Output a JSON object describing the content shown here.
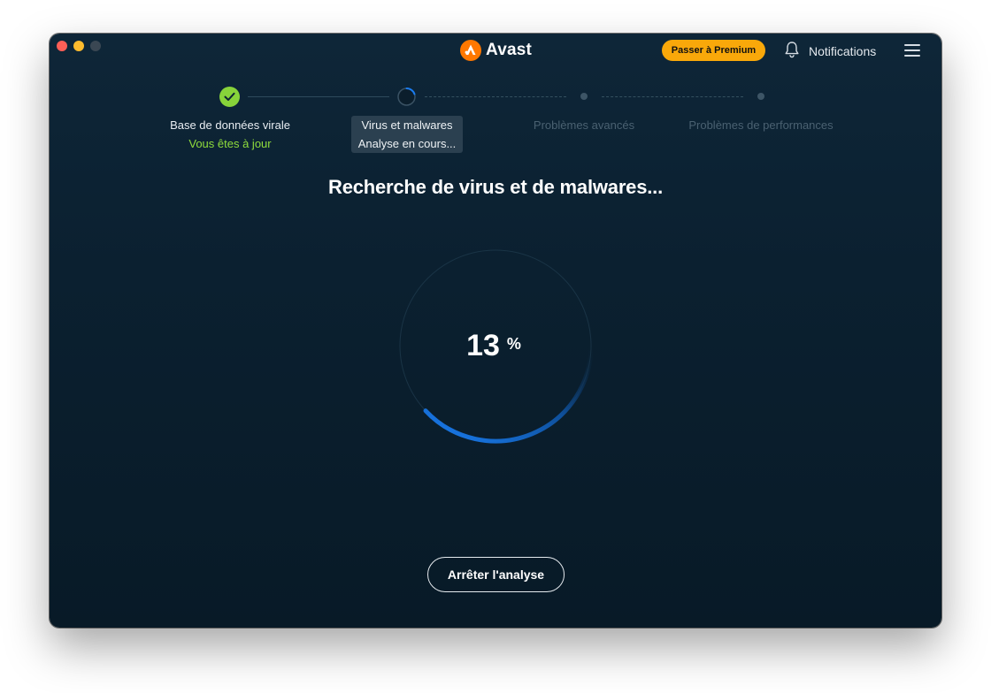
{
  "window": {
    "controls": [
      "close",
      "minimize",
      "zoom"
    ]
  },
  "header": {
    "app_name": "Avast",
    "logo_icon": "avast-logo-icon",
    "premium_label": "Passer à Premium",
    "notifications_label": "Notifications",
    "notifications_icon": "bell-icon",
    "menu_icon": "hamburger-menu-icon"
  },
  "steps": [
    {
      "title": "Base de données virale",
      "subtitle": "Vous êtes à jour",
      "status": "done"
    },
    {
      "title": "Virus et malwares",
      "subtitle": "Analyse en cours...",
      "status": "in-progress"
    },
    {
      "title": "Problèmes avancés",
      "status": "pending"
    },
    {
      "title": "Problèmes de performances",
      "status": "pending"
    }
  ],
  "scan": {
    "headline": "Recherche de virus et de malwares...",
    "progress_value": "13",
    "progress_unit": "%",
    "progress_fraction": 0.13,
    "stop_label": "Arrêter l'analyse"
  },
  "colors": {
    "accent_blue": "#1a7cf0",
    "success_green": "#87d33a",
    "premium_yellow": "#f9a80a",
    "brand_orange": "#ff7800"
  }
}
